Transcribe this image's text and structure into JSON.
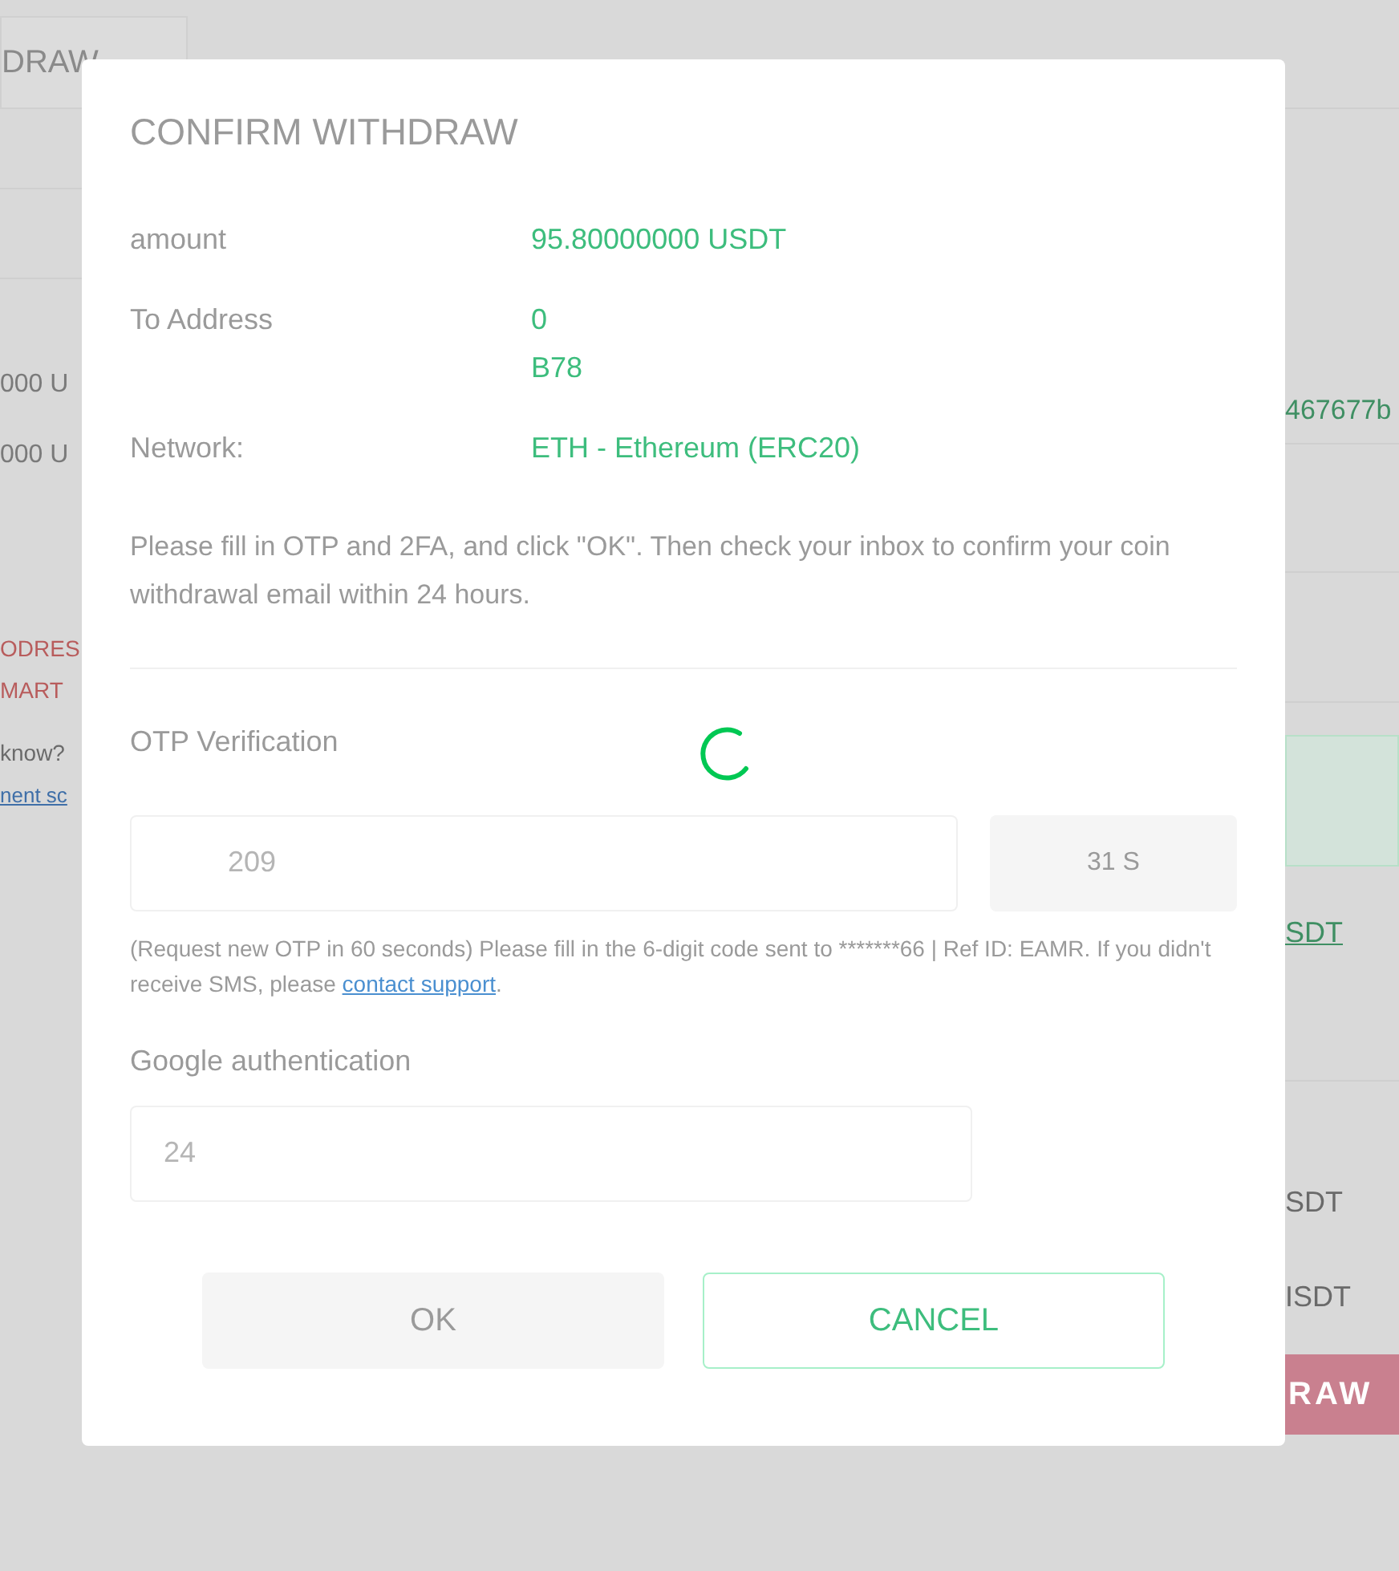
{
  "background": {
    "tab": "DRAW",
    "left_amounts": [
      "000 U",
      "000 U"
    ],
    "left_warnings": [
      "ODRES",
      "MART"
    ],
    "left_question": "know?",
    "left_link": "nent sc",
    "right_address": "467677b",
    "right_link": "SDT",
    "right_amounts": [
      "SDT",
      "ISDT"
    ],
    "right_button": "RAW"
  },
  "dialog": {
    "title": "CONFIRM WITHDRAW",
    "details": [
      {
        "label": "amount",
        "lines": [
          "95.80000000 USDT"
        ]
      },
      {
        "label": "To Address",
        "lines": [
          "0",
          "B78"
        ]
      },
      {
        "label": "Network:",
        "lines": [
          "ETH - Ethereum (ERC20)"
        ]
      }
    ],
    "instructions": "Please fill in OTP and 2FA, and click \"OK\". Then check your inbox to confirm your coin withdrawal email within 24 hours.",
    "loading": true,
    "otp": {
      "label": "OTP Verification",
      "value": "209",
      "resend_button": "31 S",
      "resend_disabled": true,
      "hint": "(Request new OTP in 60 seconds) Please fill in the 6-digit code sent to *******66 | Ref ID: EAMR. If you didn't receive SMS, please ",
      "hint_link": "contact support",
      "hint_end": "."
    },
    "google": {
      "label": "Google authentication",
      "value": "24"
    },
    "buttons": [
      {
        "label": "OK",
        "kind": "primary",
        "disabled": true
      },
      {
        "label": "CANCEL",
        "kind": "outline",
        "disabled": false
      }
    ]
  }
}
